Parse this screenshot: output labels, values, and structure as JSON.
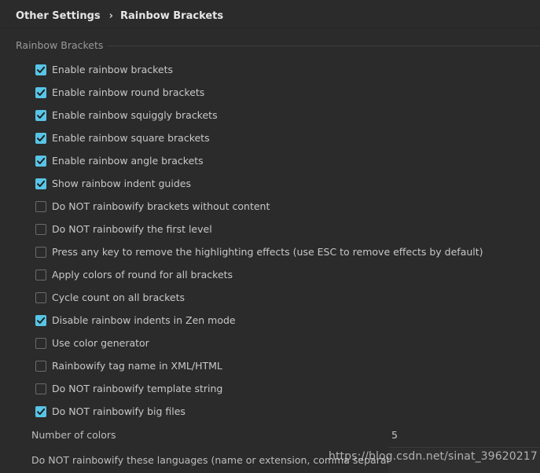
{
  "breadcrumb": {
    "parent": "Other Settings",
    "separator": "›",
    "current": "Rainbow Brackets"
  },
  "group": {
    "title": "Rainbow Brackets"
  },
  "options": [
    {
      "label": "Enable rainbow brackets",
      "checked": true
    },
    {
      "label": "Enable rainbow round brackets",
      "checked": true
    },
    {
      "label": "Enable rainbow squiggly brackets",
      "checked": true
    },
    {
      "label": "Enable rainbow square brackets",
      "checked": true
    },
    {
      "label": "Enable rainbow angle brackets",
      "checked": true
    },
    {
      "label": "Show rainbow indent guides",
      "checked": true
    },
    {
      "label": "Do NOT rainbowify brackets without content",
      "checked": false
    },
    {
      "label": "Do NOT rainbowify the first level",
      "checked": false
    },
    {
      "label": "Press any key to remove the highlighting effects (use ESC to remove effects by default)",
      "checked": false
    },
    {
      "label": "Apply colors of round for all brackets",
      "checked": false
    },
    {
      "label": "Cycle count on all brackets",
      "checked": false
    },
    {
      "label": "Disable rainbow indents in Zen mode",
      "checked": true
    },
    {
      "label": "Use color generator",
      "checked": false
    },
    {
      "label": "Rainbowify tag name in XML/HTML",
      "checked": false
    },
    {
      "label": "Do NOT rainbowify template string",
      "checked": false
    },
    {
      "label": "Do NOT rainbowify big files",
      "checked": true
    }
  ],
  "number_of_colors": {
    "label": "Number of colors",
    "value": "5"
  },
  "languages": {
    "label": "Do NOT rainbowify these languages (name or extension, comma separated, ",
    "value": ""
  },
  "watermark": "https://blog.csdn.net/sinat_39620217",
  "colors": {
    "background": "#2b2b2b",
    "checkbox_on": "#58c4e6",
    "checkbox_border_off": "#6b6b6b",
    "text": "#c8c8c8"
  }
}
